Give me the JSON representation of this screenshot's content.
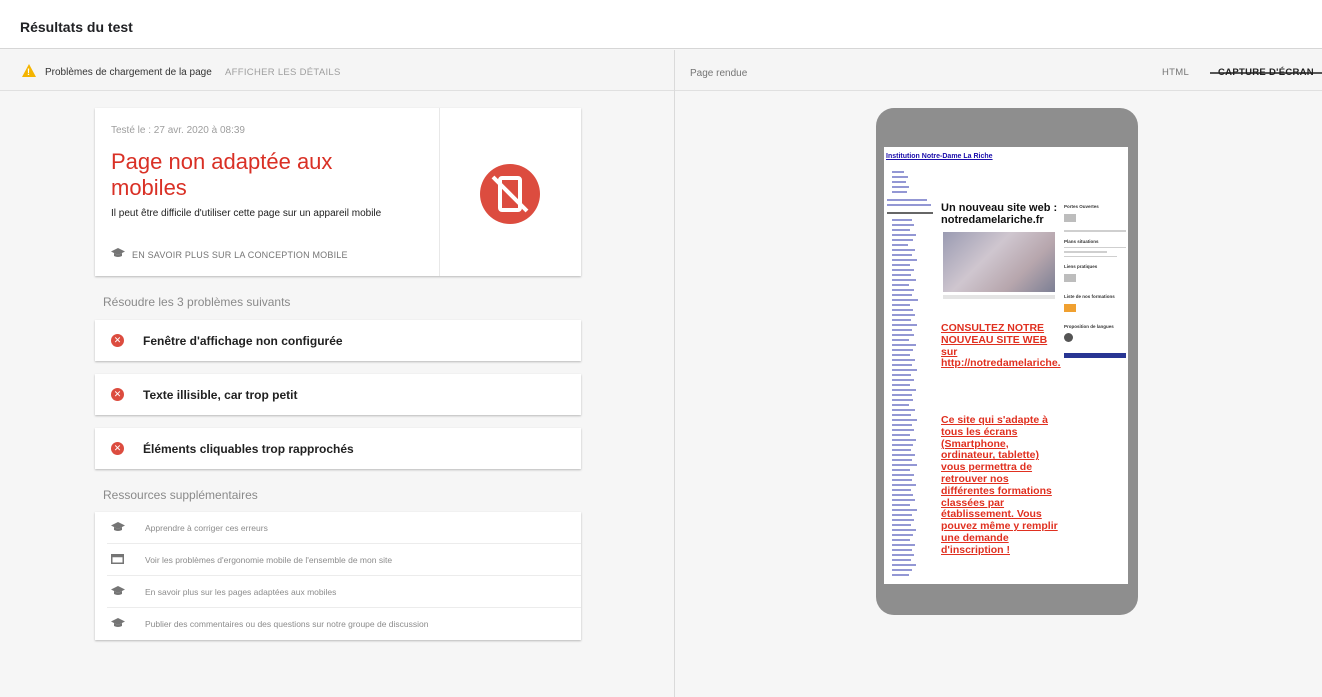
{
  "header": {
    "title": "Résultats du test"
  },
  "status_bar": {
    "issue_text": "Problèmes de chargement de la page",
    "details_link": "AFFICHER LES DÉTAILS"
  },
  "right_panel": {
    "rendered_label": "Page rendue",
    "tabs": [
      {
        "label": "HTML",
        "active": false
      },
      {
        "label": "CAPTURE D'ÉCRAN",
        "active": true
      }
    ]
  },
  "verdict": {
    "date": "Testé le : 27 avr. 2020 à 08:39",
    "headline": "Page non adaptée aux mobiles",
    "subtext": "Il peut être difficile d'utiliser cette page sur un appareil mobile",
    "learn_more": "EN SAVOIR PLUS SUR LA CONCEPTION MOBILE",
    "icon": "not-mobile-friendly-icon",
    "accent_color": "#d93025"
  },
  "problems": {
    "title": "Résoudre les 3 problèmes suivants",
    "items": [
      {
        "label": "Fenêtre d'affichage non configurée",
        "icon": "error-icon"
      },
      {
        "label": "Texte illisible, car trop petit",
        "icon": "error-icon"
      },
      {
        "label": "Éléments cliquables trop rapprochés",
        "icon": "error-icon"
      }
    ]
  },
  "resources": {
    "title": "Ressources supplémentaires",
    "items": [
      {
        "label": "Apprendre à corriger ces erreurs",
        "icon": "graduation-cap-icon"
      },
      {
        "label": "Voir les problèmes d'ergonomie mobile de l'ensemble de mon site",
        "icon": "window-icon"
      },
      {
        "label": "En savoir plus sur les pages adaptées aux mobiles",
        "icon": "graduation-cap-icon"
      },
      {
        "label": "Publier des commentaires ou des questions sur notre groupe de discussion",
        "icon": "graduation-cap-icon"
      }
    ]
  },
  "screenshot": {
    "site_title": "Institution Notre-Dame La Riche",
    "headline": "Un nouveau site web : notredamelariche.fr",
    "promo": "CONSULTEZ NOTRE NOUVEAU SITE WEB sur http://notredamelariche.",
    "promo2": "Ce site qui s'adapte à tous les écrans (Smartphone, ordinateur, tablette) vous permettra de retrouver nos différentes formations classées par établissement. Vous pouvez même y remplir une demande d'inscription !",
    "sidebar": {
      "portes_ouvertes": "Portes Ouvertes",
      "plans": "Plans situations",
      "liens": "Liens pratiques",
      "formations": "Liste de nos formations",
      "langues": "Proposition de langues"
    }
  }
}
